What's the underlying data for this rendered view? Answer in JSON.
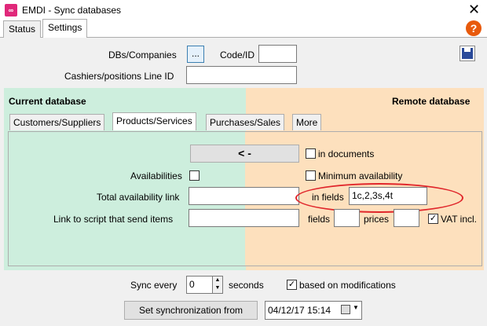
{
  "window": {
    "title": "EMDI - Sync databases",
    "icon_text": "∞"
  },
  "tabs": [
    {
      "label": "Status"
    },
    {
      "label": "Settings"
    }
  ],
  "top_form": {
    "dbs_label": "DBs/Companies",
    "dbs_button": "...",
    "code_label": "Code/ID",
    "code_value": "",
    "cashiers_label": "Cashiers/positions Line ID",
    "cashiers_value": ""
  },
  "panel": {
    "current_label": "Current database",
    "remote_label": "Remote database",
    "tabs": [
      {
        "label": "Customers/Suppliers"
      },
      {
        "label": "Products/Services"
      },
      {
        "label": "Purchases/Sales"
      },
      {
        "label": "More"
      }
    ],
    "arrow_button": "<  -",
    "in_documents_label": "in documents",
    "availabilities_label": "Availabilities",
    "min_availability_label": "Minimum availability",
    "total_link_label": "Total availability link",
    "total_link_value": "",
    "in_fields_label": "in fields",
    "in_fields_value": "1c,2,3s,4t",
    "script_label": "Link to script that send items",
    "script_value": "",
    "fields_label": "fields",
    "fields_value": "",
    "prices_label": "prices",
    "prices_value": "",
    "vat_label": "VAT incl."
  },
  "bottom": {
    "sync_every_label": "Sync every",
    "sync_value": "0",
    "seconds_label": "seconds",
    "based_label": "based on modifications",
    "set_sync_button": "Set synchronization from",
    "date_value": "04/12/17 15:14"
  },
  "colors": {
    "left_bg": "#cdeedd",
    "right_bg": "#fde0bd",
    "highlight": "#e0262b"
  }
}
